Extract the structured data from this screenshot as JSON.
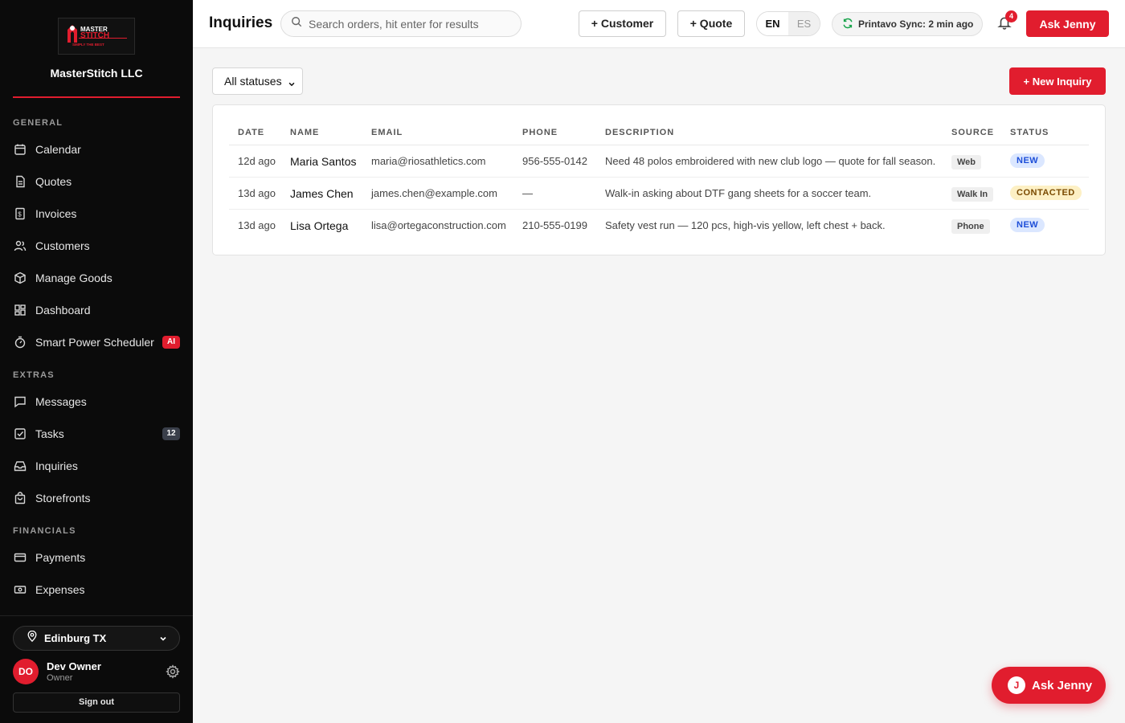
{
  "sidebar": {
    "brand": {
      "logo_top": "MASTER",
      "logo_main": "STITCH",
      "logo_tag": "SIMPLY THE BEST"
    },
    "org_name": "MasterStitch LLC",
    "sections": [
      {
        "label": "GENERAL"
      },
      {
        "label": "EXTRAS"
      },
      {
        "label": "FINANCIALS"
      }
    ],
    "items": [
      {
        "label": "Calendar",
        "icon": "calendar-icon"
      },
      {
        "label": "Quotes",
        "icon": "document-icon"
      },
      {
        "label": "Invoices",
        "icon": "invoice-icon"
      },
      {
        "label": "Customers",
        "icon": "users-icon"
      },
      {
        "label": "Manage Goods",
        "icon": "box-icon"
      },
      {
        "label": "Dashboard",
        "icon": "dashboard-icon"
      },
      {
        "label": "Smart Power Scheduler",
        "icon": "timer-icon",
        "badge": "AI"
      },
      {
        "label": "Messages",
        "icon": "message-icon"
      },
      {
        "label": "Tasks",
        "icon": "checkbox-icon",
        "badge": "12"
      },
      {
        "label": "Inquiries",
        "icon": "inbox-icon"
      },
      {
        "label": "Storefronts",
        "icon": "bag-icon"
      },
      {
        "label": "Payments",
        "icon": "card-icon"
      },
      {
        "label": "Expenses",
        "icon": "cash-icon"
      }
    ],
    "location": "Edinburg TX",
    "user": {
      "initials": "DO",
      "name": "Dev Owner",
      "role": "Owner"
    },
    "sign_out": "Sign out"
  },
  "header": {
    "title": "Inquiries",
    "search_placeholder": "Search orders, hit enter for results",
    "customer_button": "+ Customer",
    "quote_button": "+ Quote",
    "lang_en": "EN",
    "lang_es": "ES",
    "sync_status": "Printavo Sync: 2 min ago",
    "notification_count": "4",
    "ask_button": "Ask Jenny"
  },
  "main": {
    "status_filter": "All statuses",
    "new_inquiry_button": "+ New Inquiry",
    "table": {
      "columns": [
        "DATE",
        "NAME",
        "EMAIL",
        "PHONE",
        "DESCRIPTION",
        "SOURCE",
        "STATUS"
      ],
      "rows": [
        {
          "date": "12d ago",
          "name": "Maria Santos",
          "email": "maria@riosathletics.com",
          "phone": "956-555-0142",
          "description": "Need 48 polos embroidered with new club logo — quote for fall season.",
          "source": "Web",
          "status": "NEW"
        },
        {
          "date": "13d ago",
          "name": "James Chen",
          "email": "james.chen@example.com",
          "phone": "—",
          "description": "Walk-in asking about DTF gang sheets for a soccer team.",
          "source": "Walk In",
          "status": "CONTACTED"
        },
        {
          "date": "13d ago",
          "name": "Lisa Ortega",
          "email": "lisa@ortegaconstruction.com",
          "phone": "210-555-0199",
          "description": "Safety vest run — 120 pcs, high-vis yellow, left chest + back.",
          "source": "Phone",
          "status": "NEW"
        }
      ]
    }
  },
  "fab": {
    "initial": "J",
    "label": "Ask Jenny"
  },
  "colors": {
    "brand_red": "#e11d2e",
    "sidebar_bg": "#0b0b0b",
    "status_new_bg": "#dbe7ff",
    "status_new_fg": "#1d4ed8",
    "status_contacted_bg": "#fdf0c4",
    "status_contacted_fg": "#7a4a00",
    "sync_green": "#16a34a"
  }
}
